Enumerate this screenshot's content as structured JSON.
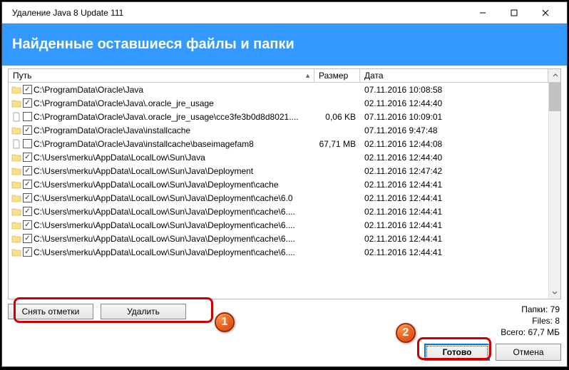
{
  "window": {
    "title": "Удаление Java 8 Update 111"
  },
  "banner": "Найденные оставшиеся файлы и папки",
  "columns": {
    "path": "Путь",
    "size": "Размер",
    "date": "Дата"
  },
  "rows": [
    {
      "type": "folder",
      "checked": true,
      "path": "C:\\ProgramData\\Oracle\\Java",
      "size": "",
      "date": "07.11.2016 10:08:58"
    },
    {
      "type": "folder",
      "checked": true,
      "path": "C:\\ProgramData\\Oracle\\Java\\.oracle_jre_usage",
      "size": "",
      "date": "02.11.2016 12:44:40"
    },
    {
      "type": "file",
      "checked": false,
      "path": "C:\\ProgramData\\Oracle\\Java\\.oracle_jre_usage\\cce3fe3b0d8d8021....",
      "size": "0,06 KB",
      "date": "07.11.2016 10:09:01"
    },
    {
      "type": "folder",
      "checked": true,
      "path": "C:\\ProgramData\\Oracle\\Java\\installcache",
      "size": "",
      "date": "07.11.2016 9:47:48"
    },
    {
      "type": "file",
      "checked": false,
      "path": "C:\\ProgramData\\Oracle\\Java\\installcache\\baseimagefam8",
      "size": "67,71 MB",
      "date": "02.11.2016 12:44:08"
    },
    {
      "type": "folder",
      "checked": true,
      "path": "C:\\Users\\merku\\AppData\\LocalLow\\Sun\\Java",
      "size": "",
      "date": "02.11.2016 12:44:40"
    },
    {
      "type": "folder",
      "checked": true,
      "path": "C:\\Users\\merku\\AppData\\LocalLow\\Sun\\Java\\Deployment",
      "size": "",
      "date": "02.11.2016 12:47:42"
    },
    {
      "type": "folder",
      "checked": true,
      "path": "C:\\Users\\merku\\AppData\\LocalLow\\Sun\\Java\\Deployment\\cache",
      "size": "",
      "date": "02.11.2016 12:44:41"
    },
    {
      "type": "folder",
      "checked": true,
      "path": "C:\\Users\\merku\\AppData\\LocalLow\\Sun\\Java\\Deployment\\cache\\6.0",
      "size": "",
      "date": "02.11.2016 12:44:41"
    },
    {
      "type": "folder",
      "checked": true,
      "path": "C:\\Users\\merku\\AppData\\LocalLow\\Sun\\Java\\Deployment\\cache\\6....",
      "size": "",
      "date": "02.11.2016 12:44:41"
    },
    {
      "type": "folder",
      "checked": true,
      "path": "C:\\Users\\merku\\AppData\\LocalLow\\Sun\\Java\\Deployment\\cache\\6....",
      "size": "",
      "date": "02.11.2016 12:44:41"
    },
    {
      "type": "folder",
      "checked": true,
      "path": "C:\\Users\\merku\\AppData\\LocalLow\\Sun\\Java\\Deployment\\cache\\6....",
      "size": "",
      "date": "02.11.2016 12:44:41"
    },
    {
      "type": "folder",
      "checked": true,
      "path": "C:\\Users\\merku\\AppData\\LocalLow\\Sun\\Java\\Deployment\\cache\\6....",
      "size": "",
      "date": "02.11.2016 12:44:41"
    }
  ],
  "buttons": {
    "uncheck": "Снять отметки",
    "delete": "Удалить",
    "done": "Готово",
    "cancel": "Отмена"
  },
  "stats": {
    "folders_label": "Папки:",
    "folders_value": "79",
    "files_label": "Files:",
    "files_value": "8",
    "total_label": "Всего:",
    "total_value": "67,7 МБ"
  },
  "callouts": {
    "one": "1",
    "two": "2"
  }
}
